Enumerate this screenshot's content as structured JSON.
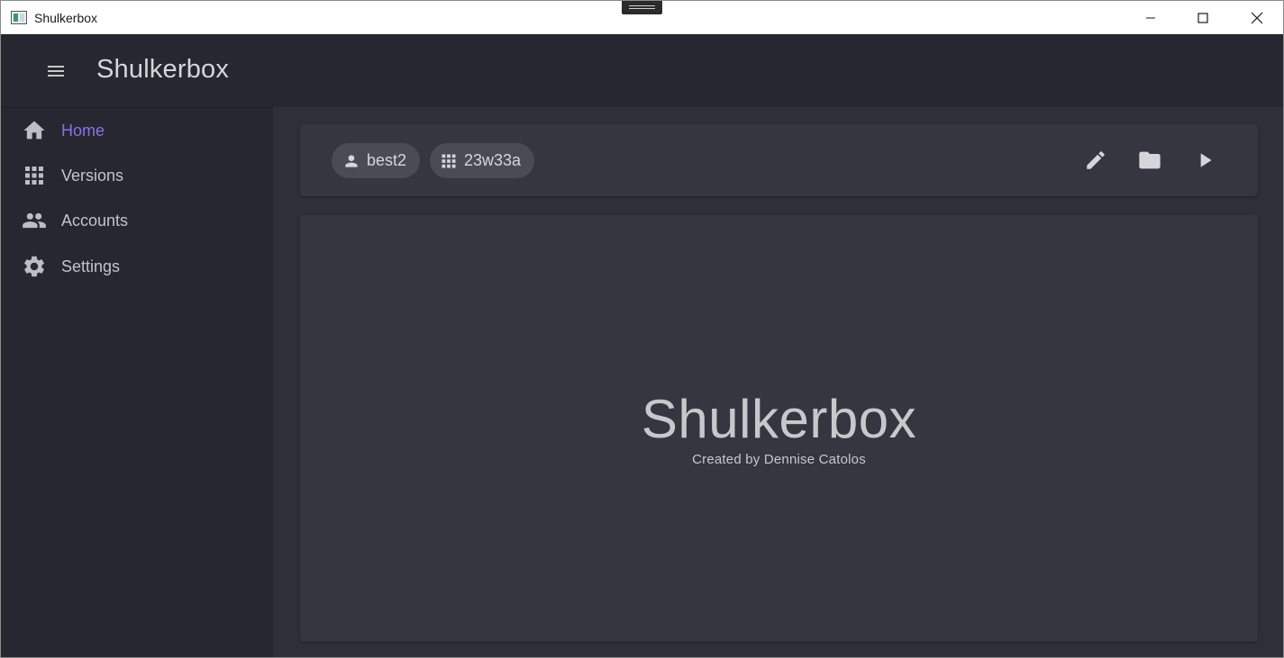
{
  "window": {
    "title": "Shulkerbox",
    "controls": {
      "minimize_icon": "minimize-icon",
      "maximize_icon": "maximize-icon",
      "close_icon": "close-icon"
    }
  },
  "appbar": {
    "menu_icon": "menu-icon",
    "title": "Shulkerbox"
  },
  "sidebar": {
    "items": [
      {
        "label": "Home",
        "icon": "home-icon",
        "active": true
      },
      {
        "label": "Versions",
        "icon": "grid-icon",
        "active": false
      },
      {
        "label": "Accounts",
        "icon": "people-icon",
        "active": false
      },
      {
        "label": "Settings",
        "icon": "gear-icon",
        "active": false
      }
    ]
  },
  "toolbar": {
    "account_chip": {
      "label": "best2",
      "icon": "person-icon"
    },
    "version_chip": {
      "label": "23w33a",
      "icon": "grid-icon"
    },
    "actions": [
      {
        "name": "edit",
        "icon": "pencil-icon"
      },
      {
        "name": "open-folder",
        "icon": "folder-icon"
      },
      {
        "name": "play",
        "icon": "play-icon"
      }
    ]
  },
  "hero": {
    "title": "Shulkerbox",
    "subtitle": "Created by Dennise Catolos"
  },
  "colors": {
    "accent": "#8a72e8",
    "appbar_bg": "#262730",
    "main_bg": "#2e2f38",
    "card_bg": "#35363f",
    "chip_bg": "#4a4b54",
    "text": "#c8c8cc"
  }
}
